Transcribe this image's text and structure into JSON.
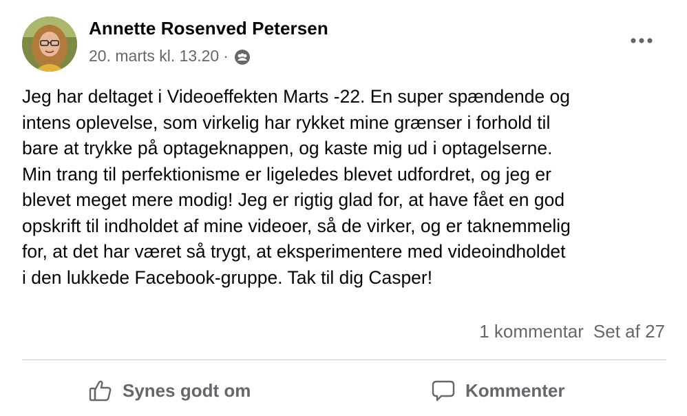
{
  "post": {
    "author": "Annette Rosenved Petersen",
    "timestamp": "20. marts kl. 13.20",
    "separator": "·",
    "audience_icon": "group-icon",
    "text": "Jeg har deltaget i Videoeffekten Marts -22. En super spændende og\nintens oplevelse, som virkelig har rykket mine grænser i forhold til\nbare at trykke på optageknappen, og kaste mig ud i optagelserne.\nMin trang til perfektionisme er ligeledes blevet udfordret, og jeg er\nblevet meget mere modig! Jeg er rigtig glad for, at have fået en god\nopskrift til indholdet af mine videoer, så de virker, og er taknemmelig\nfor, at det har været så trygt, at eksperimentere med videoindholdet\ni den lukkede Facebook-gruppe. Tak til dig Casper!"
  },
  "stats": {
    "comments": "1 kommentar",
    "seen": "Set af 27"
  },
  "actions": {
    "like_label": "Synes godt om",
    "comment_label": "Kommenter"
  },
  "colors": {
    "text": "#050505",
    "secondary": "#65676b",
    "divider": "#ced0d4"
  }
}
